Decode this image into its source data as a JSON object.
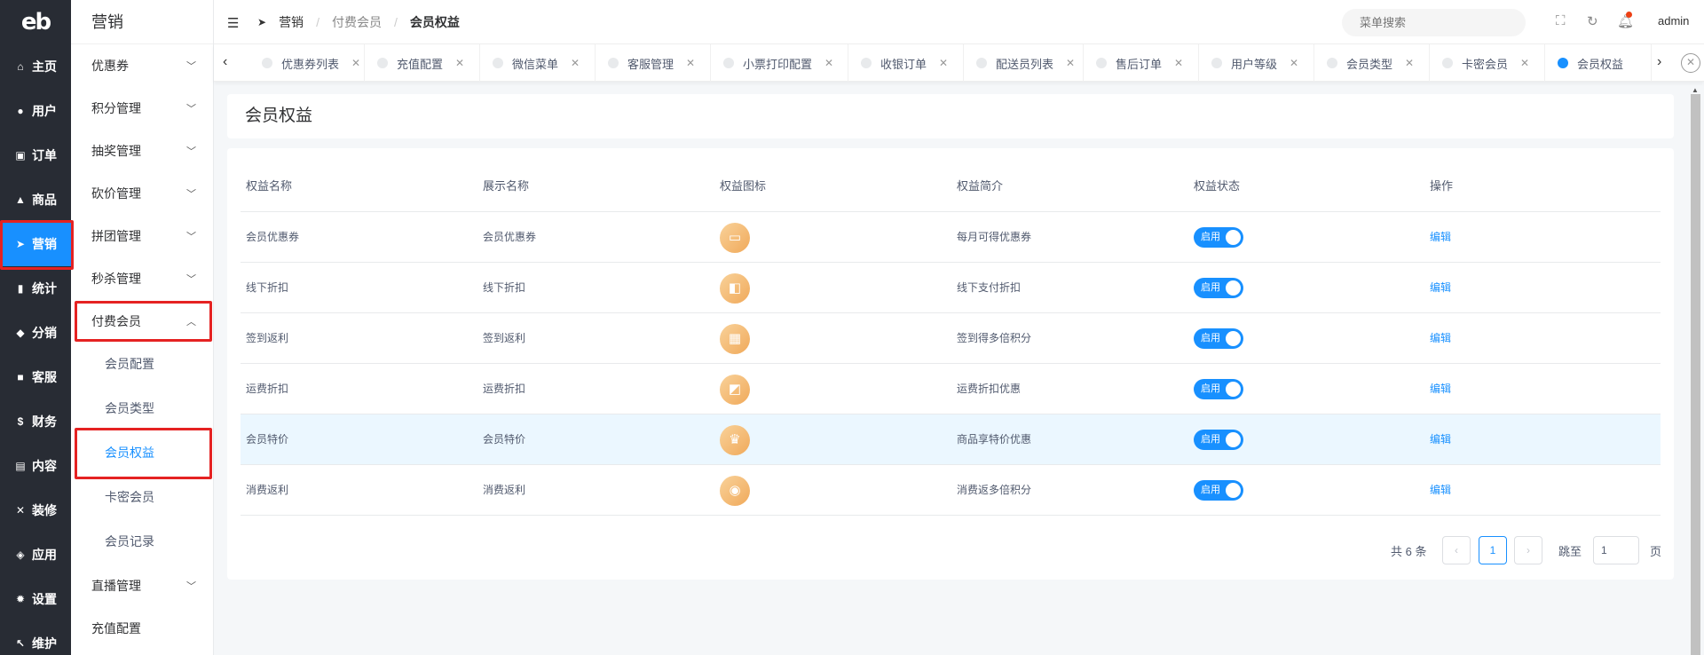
{
  "rail": {
    "logo": "eb",
    "items": [
      {
        "label": "主页",
        "icon": "home-icon",
        "glyph": "⌂"
      },
      {
        "label": "用户",
        "icon": "user-icon",
        "glyph": "●"
      },
      {
        "label": "订单",
        "icon": "cart-icon",
        "glyph": "▣"
      },
      {
        "label": "商品",
        "icon": "shop-icon",
        "glyph": "▲"
      },
      {
        "label": "营销",
        "icon": "send-icon",
        "glyph": "➤"
      },
      {
        "label": "统计",
        "icon": "bar-chart-icon",
        "glyph": "▮"
      },
      {
        "label": "分销",
        "icon": "group-icon",
        "glyph": "◆"
      },
      {
        "label": "客服",
        "icon": "chat-icon",
        "glyph": "■"
      },
      {
        "label": "财务",
        "icon": "dollar-icon",
        "glyph": "$"
      },
      {
        "label": "内容",
        "icon": "book-icon",
        "glyph": "▤"
      },
      {
        "label": "装修",
        "icon": "tools-icon",
        "glyph": "✕"
      },
      {
        "label": "应用",
        "icon": "cube-icon",
        "glyph": "◈"
      },
      {
        "label": "设置",
        "icon": "gear-icon",
        "glyph": "✹"
      },
      {
        "label": "维护",
        "icon": "wrench-icon",
        "glyph": "↖"
      }
    ]
  },
  "submenu": {
    "title": "营销",
    "items": [
      {
        "label": "优惠券"
      },
      {
        "label": "积分管理"
      },
      {
        "label": "抽奖管理"
      },
      {
        "label": "砍价管理"
      },
      {
        "label": "拼团管理"
      },
      {
        "label": "秒杀管理"
      },
      {
        "label": "付费会员"
      },
      {
        "label": "会员配置"
      },
      {
        "label": "会员类型"
      },
      {
        "label": "会员权益"
      },
      {
        "label": "卡密会员"
      },
      {
        "label": "会员记录"
      },
      {
        "label": "直播管理"
      },
      {
        "label": "充值配置"
      }
    ]
  },
  "header": {
    "breadcrumb": [
      "营销",
      "付费会员",
      "会员权益"
    ],
    "search_placeholder": "菜单搜索",
    "user": "admin"
  },
  "tabs": [
    {
      "label": "优惠券列表"
    },
    {
      "label": "充值配置"
    },
    {
      "label": "微信菜单"
    },
    {
      "label": "客服管理"
    },
    {
      "label": "小票打印配置"
    },
    {
      "label": "收银订单"
    },
    {
      "label": "配送员列表"
    },
    {
      "label": "售后订单"
    },
    {
      "label": "用户等级"
    },
    {
      "label": "会员类型"
    },
    {
      "label": "卡密会员"
    },
    {
      "label": "会员权益"
    }
  ],
  "page_title": "会员权益",
  "table": {
    "headers": [
      "权益名称",
      "展示名称",
      "权益图标",
      "权益简介",
      "权益状态",
      "操作"
    ],
    "rows": [
      {
        "name": "会员优惠券",
        "display": "会员优惠券",
        "icon": "ticket-icon",
        "glyph": "▭",
        "intro": "每月可得优惠券",
        "status": "启用",
        "action": "编辑"
      },
      {
        "name": "线下折扣",
        "display": "线下折扣",
        "icon": "wallet-icon",
        "glyph": "◧",
        "intro": "线下支付折扣",
        "status": "启用",
        "action": "编辑"
      },
      {
        "name": "签到返利",
        "display": "签到返利",
        "icon": "calendar-icon",
        "glyph": "▦",
        "intro": "签到得多倍积分",
        "status": "启用",
        "action": "编辑"
      },
      {
        "name": "运费折扣",
        "display": "运费折扣",
        "icon": "tag-icon",
        "glyph": "◩",
        "intro": "运费折扣优惠",
        "status": "启用",
        "action": "编辑"
      },
      {
        "name": "会员特价",
        "display": "会员特价",
        "icon": "crown-icon",
        "glyph": "♛",
        "intro": "商品享特价优惠",
        "status": "启用",
        "action": "编辑"
      },
      {
        "name": "消费返利",
        "display": "消费返利",
        "icon": "coin-icon",
        "glyph": "◉",
        "intro": "消费返多倍积分",
        "status": "启用",
        "action": "编辑"
      }
    ]
  },
  "pagination": {
    "total": "共 6 条",
    "current": "1",
    "jump_label": "跳至",
    "jump_value": "1",
    "page_unit": "页"
  }
}
